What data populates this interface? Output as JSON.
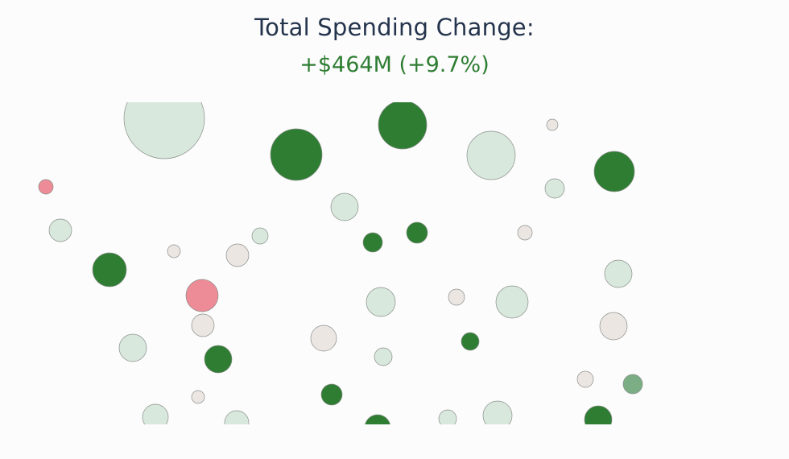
{
  "header": {
    "title": "Total Spending Change:",
    "summary": "+$464M (+9.7%)"
  },
  "chart_data": {
    "type": "scatter",
    "encoding": "bubble size = spending amount; bubble color = spending change",
    "colors": {
      "strong_increase": "#2e7d32",
      "moderate_increase": "#7bae84",
      "slight_increase": "#d8e8dc",
      "neutral": "#ece6e3",
      "decrease": "#ed8b96",
      "stroke": "#8a8f8b"
    },
    "bubbles": [
      {
        "size": 50,
        "color": "slight_increase"
      },
      {
        "size": 32,
        "color": "strong_increase"
      },
      {
        "size": 30,
        "color": "strong_increase"
      },
      {
        "size": 30,
        "color": "slight_increase"
      },
      {
        "size": 7,
        "color": "neutral"
      },
      {
        "size": 9,
        "color": "decrease"
      },
      {
        "size": 25,
        "color": "strong_increase"
      },
      {
        "size": 17,
        "color": "slight_increase"
      },
      {
        "size": 12,
        "color": "slight_increase"
      },
      {
        "size": 14,
        "color": "slight_increase"
      },
      {
        "size": 10,
        "color": "slight_increase"
      },
      {
        "size": 12,
        "color": "strong_increase"
      },
      {
        "size": 13,
        "color": "strong_increase"
      },
      {
        "size": 8,
        "color": "neutral"
      },
      {
        "size": 9,
        "color": "neutral"
      },
      {
        "size": 14,
        "color": "neutral"
      },
      {
        "size": 21,
        "color": "strong_increase"
      },
      {
        "size": 20,
        "color": "decrease"
      },
      {
        "size": 14,
        "color": "neutral"
      },
      {
        "size": 18,
        "color": "slight_increase"
      },
      {
        "size": 10,
        "color": "neutral"
      },
      {
        "size": 20,
        "color": "slight_increase"
      },
      {
        "size": 17,
        "color": "slight_increase"
      },
      {
        "size": 17,
        "color": "slight_increase"
      },
      {
        "size": 16,
        "color": "neutral"
      },
      {
        "size": 17,
        "color": "neutral"
      },
      {
        "size": 17,
        "color": "strong_increase"
      },
      {
        "size": 11,
        "color": "slight_increase"
      },
      {
        "size": 11,
        "color": "strong_increase"
      },
      {
        "size": 10,
        "color": "neutral"
      },
      {
        "size": 8,
        "color": "neutral"
      },
      {
        "size": 12,
        "color": "moderate_increase"
      },
      {
        "size": 13,
        "color": "strong_increase"
      },
      {
        "size": 16,
        "color": "slight_increase"
      },
      {
        "size": 15,
        "color": "slight_increase"
      },
      {
        "size": 11,
        "color": "slight_increase"
      },
      {
        "size": 18,
        "color": "slight_increase"
      },
      {
        "size": 16,
        "color": "strong_increase"
      },
      {
        "size": 17,
        "color": "strong_increase"
      }
    ]
  }
}
